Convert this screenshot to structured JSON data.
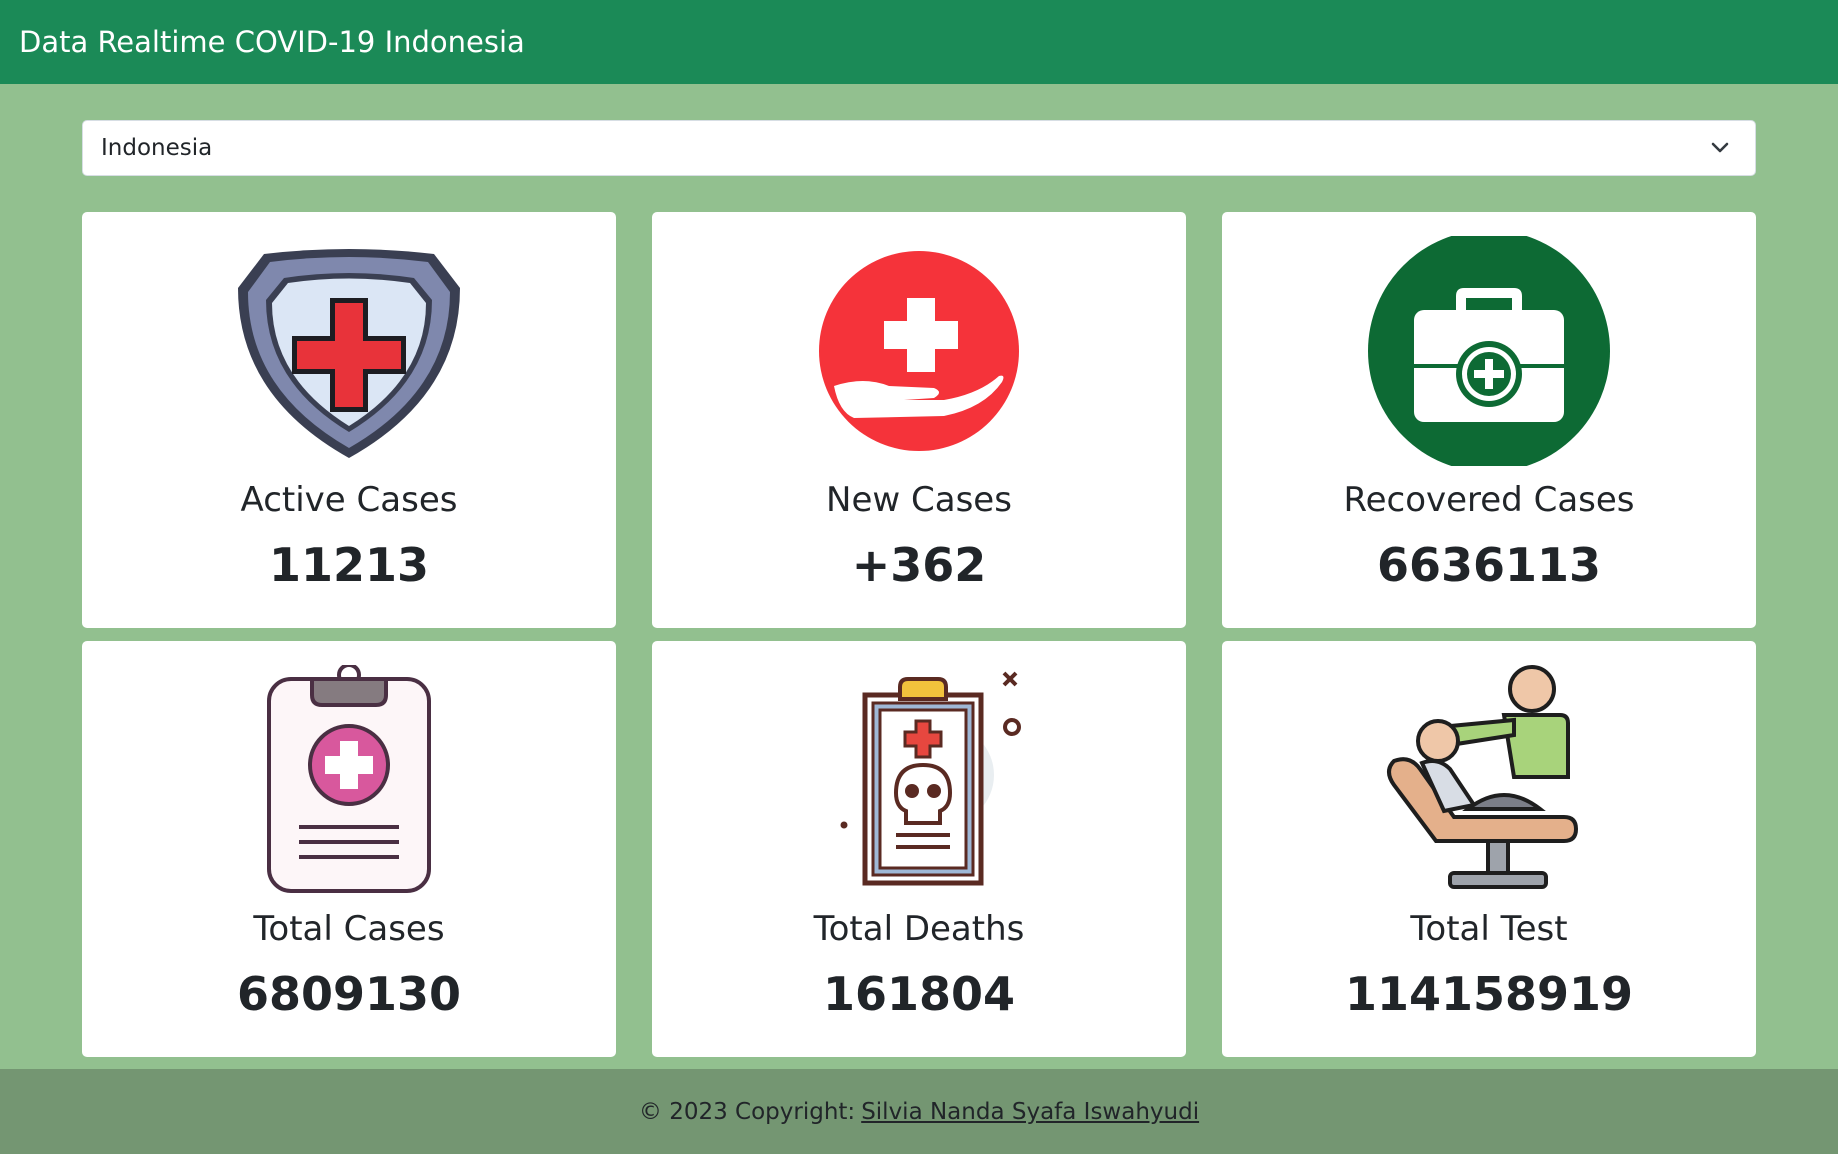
{
  "navbar": {
    "title": "Data Realtime COVID-19 Indonesia"
  },
  "country_select": {
    "selected": "Indonesia",
    "icon": "chevron-down-icon"
  },
  "cards": [
    {
      "label": "Active Cases",
      "value": "11213",
      "icon": "shield-cross-icon"
    },
    {
      "label": "New Cases",
      "value": "+362",
      "icon": "hand-cross-icon"
    },
    {
      "label": "Recovered Cases",
      "value": "6636113",
      "icon": "first-aid-kit-icon"
    },
    {
      "label": "Total Cases",
      "value": "6809130",
      "icon": "clipboard-cross-icon"
    },
    {
      "label": "Total Deaths",
      "value": "161804",
      "icon": "death-report-icon"
    },
    {
      "label": "Total Test",
      "value": "114158919",
      "icon": "doctor-patient-icon"
    }
  ],
  "footer": {
    "prefix": "© 2023 Copyright:",
    "author": "Silvia Nanda Syafa Iswahyudi"
  },
  "colors": {
    "navbar": "#1b8a57",
    "background": "#92c08f",
    "footer": "#749672"
  }
}
